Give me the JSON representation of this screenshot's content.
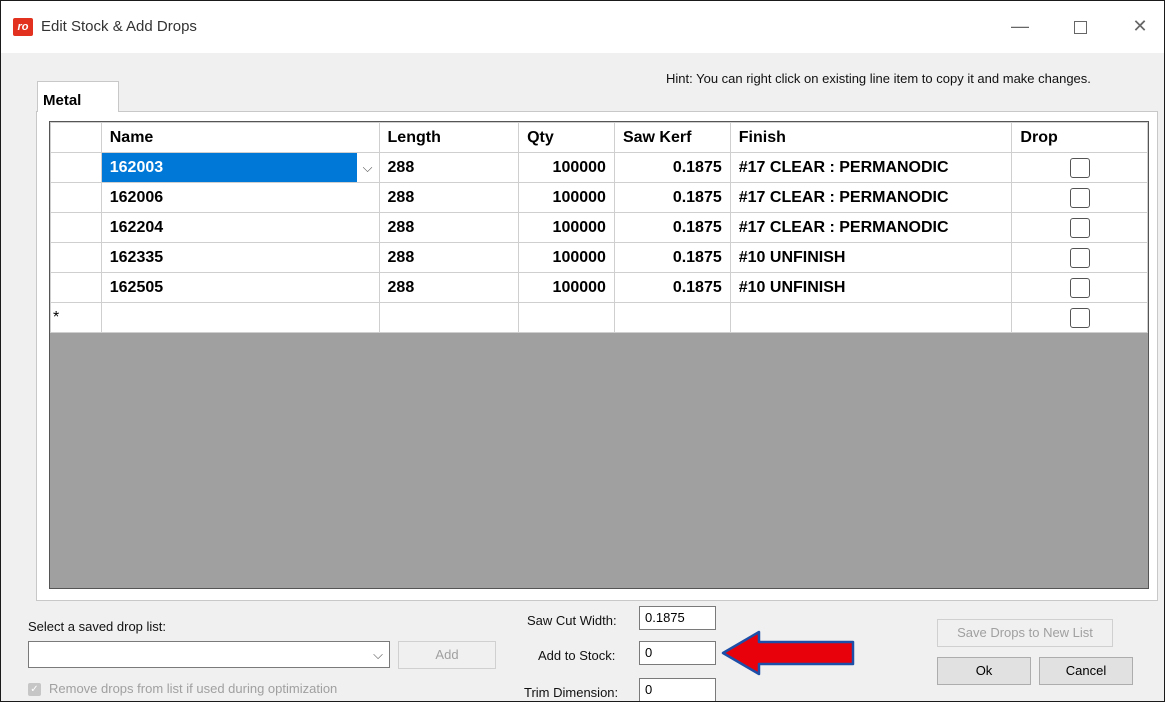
{
  "window": {
    "app_icon_text": "ro",
    "title": "Edit Stock & Add Drops",
    "minimize_glyph": "—",
    "close_glyph": "✕"
  },
  "hint": "Hint: You can right click on existing line item to copy it and make changes.",
  "tabs": [
    {
      "label": "Metal",
      "selected": true
    }
  ],
  "grid": {
    "columns": [
      "Name",
      "Length",
      "Qty",
      "Saw Kerf",
      "Finish",
      "Drop"
    ],
    "rows": [
      {
        "name": "162003",
        "length": "288",
        "qty": "100000",
        "kerf": "0.1875",
        "finish": "#17 CLEAR : PERMANODIC",
        "drop": false,
        "selected": true
      },
      {
        "name": "162006",
        "length": "288",
        "qty": "100000",
        "kerf": "0.1875",
        "finish": "#17 CLEAR : PERMANODIC",
        "drop": false
      },
      {
        "name": "162204",
        "length": "288",
        "qty": "100000",
        "kerf": "0.1875",
        "finish": "#17 CLEAR : PERMANODIC",
        "drop": false
      },
      {
        "name": "162335",
        "length": "288",
        "qty": "100000",
        "kerf": "0.1875",
        "finish": "#10 UNFINISH",
        "drop": false
      },
      {
        "name": "162505",
        "length": "288",
        "qty": "100000",
        "kerf": "0.1875",
        "finish": "#10 UNFINISH",
        "drop": false
      }
    ],
    "new_row_marker": "*"
  },
  "drop_list": {
    "label": "Select a saved drop list:",
    "value": "",
    "add_label": "Add",
    "remove_drops_label": "Remove drops from list if used during optimization",
    "remove_drops_checked": true
  },
  "fields": {
    "saw_cut_width_label": "Saw Cut Width:",
    "saw_cut_width_value": "0.1875",
    "add_to_stock_label": "Add to Stock:",
    "add_to_stock_value": "0",
    "trim_dimension_label": "Trim Dimension:",
    "trim_dimension_value": "0"
  },
  "buttons": {
    "save_drops": "Save Drops to New List",
    "ok": "Ok",
    "cancel": "Cancel"
  },
  "annotation": {
    "color": "#e8000b",
    "icon": "left-arrow-icon"
  }
}
